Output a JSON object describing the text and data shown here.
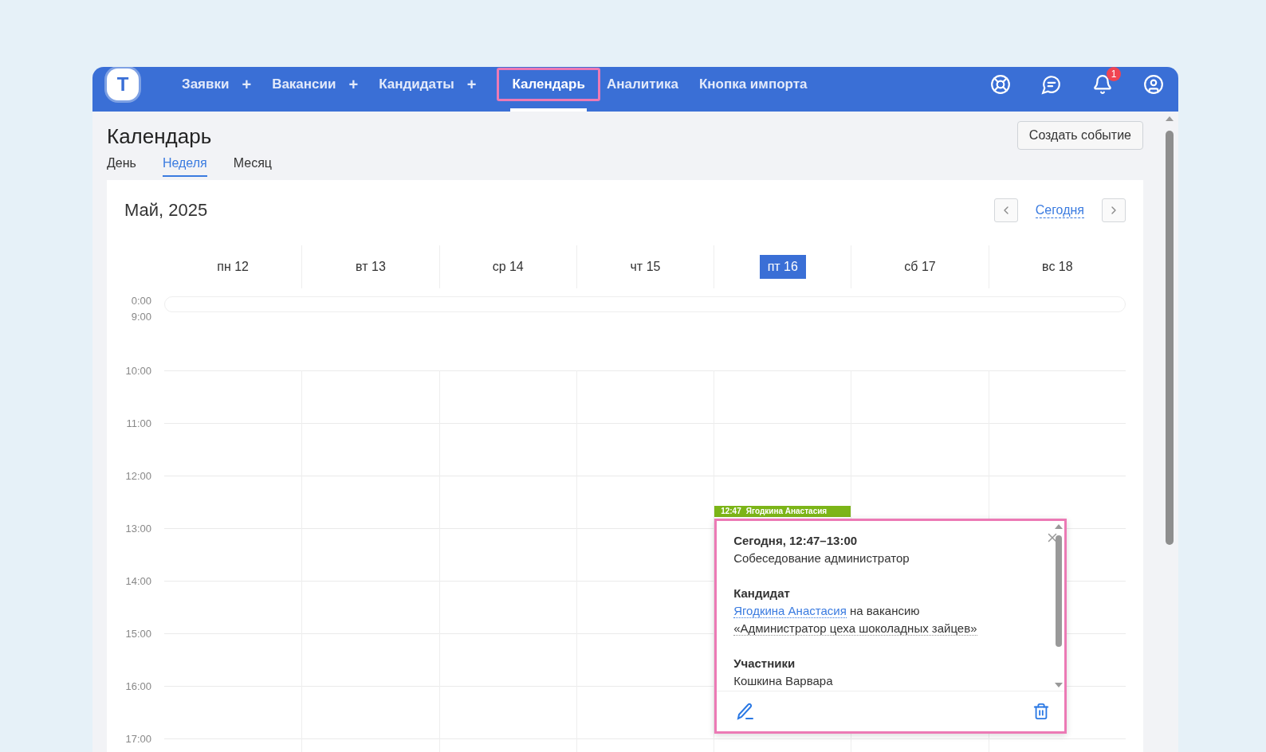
{
  "nav": {
    "logo": "T",
    "items": [
      {
        "label": "Заявки",
        "plus": "+",
        "selected": false
      },
      {
        "label": "Вакансии",
        "plus": "+",
        "selected": false
      },
      {
        "label": "Кандидаты",
        "plus": "+",
        "selected": false
      },
      {
        "label": "Календарь",
        "selected": true
      },
      {
        "label": "Аналитика",
        "selected": false
      },
      {
        "label": "Кнопка импорта",
        "selected": false
      }
    ],
    "notifications": "1"
  },
  "page": {
    "title": "Календарь",
    "create_button": "Создать событие",
    "views": [
      {
        "label": "День",
        "selected": false
      },
      {
        "label": "Неделя",
        "selected": true
      },
      {
        "label": "Месяц",
        "selected": false
      }
    ]
  },
  "calendar": {
    "month": "Май, 2025",
    "today": "Сегодня",
    "all_day_times": [
      "0:00",
      "9:00"
    ],
    "hours": [
      "10:00",
      "11:00",
      "12:00",
      "13:00",
      "14:00",
      "15:00",
      "16:00",
      "17:00"
    ],
    "days": [
      {
        "label": "пн 12",
        "selected": false
      },
      {
        "label": "вт 13",
        "selected": false
      },
      {
        "label": "ср 14",
        "selected": false
      },
      {
        "label": "чт 15",
        "selected": false
      },
      {
        "label": "пт 16",
        "selected": true,
        "events": [
          {
            "time": "12:47",
            "title": "Ягодкина Анастасия",
            "color": "#7cb518"
          }
        ]
      },
      {
        "label": "сб 17",
        "selected": false
      },
      {
        "label": "вс 18",
        "selected": false
      }
    ]
  },
  "popup": {
    "heading": "Сегодня, 12:47–13:00",
    "subtitle": "Собеседование администратор",
    "candidate_label": "Кандидат",
    "candidate_link": "Ягодкина Анастасия",
    "candidate_text": "на вакансию",
    "vacancy": "«Администратор цеха шоколадных зайцев»",
    "participants_label": "Участники",
    "participants": [
      "Кошкина Варвара"
    ]
  }
}
